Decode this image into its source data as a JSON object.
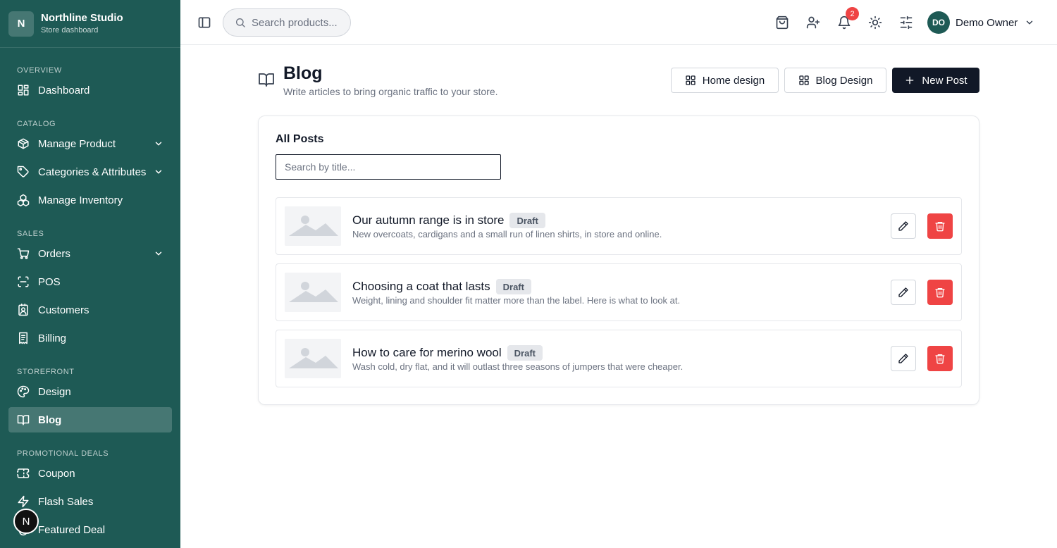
{
  "brand": {
    "logo_letter": "N",
    "name": "Northline Studio",
    "subtitle": "Store dashboard"
  },
  "sidebar": {
    "sections": [
      {
        "title": "OVERVIEW",
        "items": [
          {
            "label": "Dashboard",
            "icon": "dashboard-icon"
          }
        ]
      },
      {
        "title": "CATALOG",
        "items": [
          {
            "label": "Manage Product",
            "icon": "package-icon",
            "expandable": true
          },
          {
            "label": "Categories & Attributes",
            "icon": "tag-icon",
            "expandable": true
          },
          {
            "label": "Manage Inventory",
            "icon": "boxes-icon"
          }
        ]
      },
      {
        "title": "SALES",
        "items": [
          {
            "label": "Orders",
            "icon": "cart-icon",
            "expandable": true
          },
          {
            "label": "POS",
            "icon": "scan-icon"
          },
          {
            "label": "Customers",
            "icon": "contact-icon"
          },
          {
            "label": "Billing",
            "icon": "receipt-icon"
          }
        ]
      },
      {
        "title": "STOREFRONT",
        "items": [
          {
            "label": "Design",
            "icon": "palette-icon"
          },
          {
            "label": "Blog",
            "icon": "book-icon",
            "active": true
          }
        ]
      },
      {
        "title": "PROMOTIONAL DEALS",
        "items": [
          {
            "label": "Coupon",
            "icon": "ticket-icon"
          },
          {
            "label": "Flash Sales",
            "icon": "zap-icon"
          },
          {
            "label": "Featured Deal",
            "icon": "flame-icon"
          }
        ]
      }
    ],
    "floating_badge": "N"
  },
  "topbar": {
    "search_placeholder": "Search products...",
    "notification_count": "2",
    "user": {
      "initials": "DO",
      "name": "Demo Owner"
    },
    "icons": [
      "shopping-bag-icon",
      "user-plus-icon",
      "bell-icon",
      "sun-icon",
      "sliders-icon"
    ]
  },
  "page": {
    "title": "Blog",
    "subtitle": "Write articles to bring organic traffic to your store.",
    "buttons": {
      "home_design": "Home design",
      "blog_design": "Blog Design",
      "new_post": "New Post"
    }
  },
  "posts_card": {
    "title": "All Posts",
    "search_placeholder": "Search by title...",
    "posts": [
      {
        "title": "Our autumn range is in store",
        "status": "Draft",
        "description": "New overcoats, cardigans and a small run of linen shirts, in store and online."
      },
      {
        "title": "Choosing a coat that lasts",
        "status": "Draft",
        "description": "Weight, lining and shoulder fit matter more than the label. Here is what to look at."
      },
      {
        "title": "How to care for merino wool",
        "status": "Draft",
        "description": "Wash cold, dry flat, and it will outlast three seasons of jumpers that were cheaper."
      }
    ]
  },
  "colors": {
    "sidebar": "#1e5a55",
    "primary_button": "#111827",
    "danger": "#ef4444",
    "badge_bg": "#e5e7eb"
  }
}
